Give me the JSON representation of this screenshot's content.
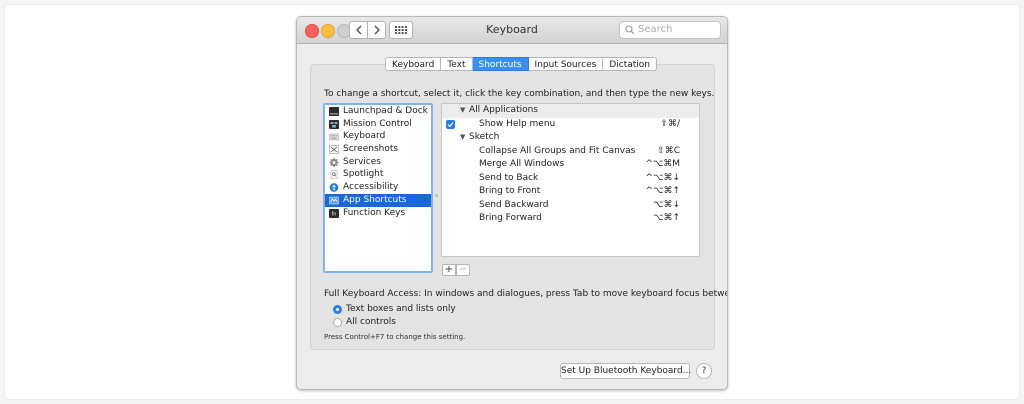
{
  "window": {
    "title": "Keyboard",
    "search_placeholder": "Search"
  },
  "tabs": [
    {
      "label": "Keyboard",
      "active": false
    },
    {
      "label": "Text",
      "active": false
    },
    {
      "label": "Shortcuts",
      "active": true
    },
    {
      "label": "Input Sources",
      "active": false
    },
    {
      "label": "Dictation",
      "active": false
    }
  ],
  "instructions": "To change a shortcut, select it, click the key combination, and then type the new keys.",
  "categories": [
    {
      "label": "Launchpad & Dock",
      "icon": "launchpad-icon",
      "selected": false
    },
    {
      "label": "Mission Control",
      "icon": "mission-control-icon",
      "selected": false
    },
    {
      "label": "Keyboard",
      "icon": "keyboard-icon",
      "selected": false
    },
    {
      "label": "Screenshots",
      "icon": "screenshot-icon",
      "selected": false
    },
    {
      "label": "Services",
      "icon": "gear-icon",
      "selected": false
    },
    {
      "label": "Spotlight",
      "icon": "spotlight-icon",
      "selected": false
    },
    {
      "label": "Accessibility",
      "icon": "accessibility-icon",
      "selected": false
    },
    {
      "label": "App Shortcuts",
      "icon": "app-shortcuts-icon",
      "selected": true
    },
    {
      "label": "Function Keys",
      "icon": "fn-icon",
      "selected": false
    }
  ],
  "shortcuts": {
    "all_apps_label": "All Applications",
    "show_help": {
      "name": "Show Help menu",
      "key": "⇧⌘/",
      "checked": true
    },
    "sketch_label": "Sketch",
    "sketch_items": [
      {
        "name": "Collapse All Groups and Fit Canvas",
        "key": "⇧⌘C"
      },
      {
        "name": "Merge All Windows",
        "key": "^⌥⌘M"
      },
      {
        "name": "Send to Back",
        "key": "^⌥⌘↓"
      },
      {
        "name": "Bring to Front",
        "key": "^⌥⌘↑"
      },
      {
        "name": "Send Backward",
        "key": "⌥⌘↓"
      },
      {
        "name": "Bring Forward",
        "key": "⌥⌘↑"
      }
    ]
  },
  "buttons": {
    "add": "+",
    "remove": "−",
    "bluetooth": "Set Up Bluetooth Keyboard...",
    "help": "?"
  },
  "keyboard_access": {
    "label": "Full Keyboard Access: In windows and dialogues, press Tab to move keyboard focus between:",
    "options": [
      {
        "label": "Text boxes and lists only",
        "selected": true
      },
      {
        "label": "All controls",
        "selected": false
      }
    ],
    "hint": "Press Control+F7 to change this setting."
  },
  "colors": {
    "accent": "#3a8ff5",
    "selection": "#1a68d8"
  }
}
